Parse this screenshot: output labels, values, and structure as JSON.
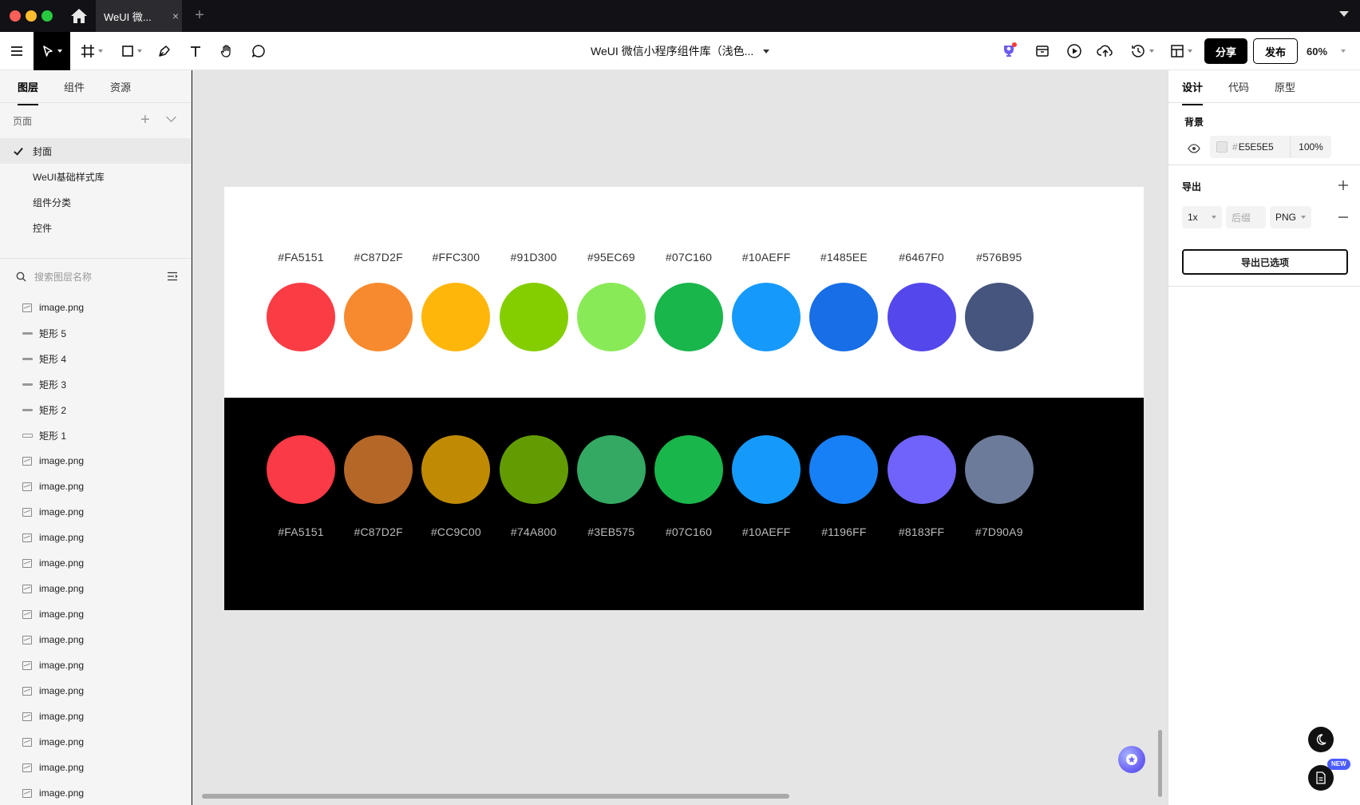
{
  "window": {
    "tab_title": "WeUI 微...",
    "tab_close": "×",
    "new_tab": "+"
  },
  "toolbar": {
    "tools": [
      "menu-icon",
      "move-tool",
      "frame-tool",
      "rectangle-tool",
      "pen-tool",
      "text-tool",
      "hand-tool",
      "comment-tool"
    ],
    "document_title": "WeUI 微信小程序组件库（浅色...",
    "share_label": "分享",
    "publish_label": "发布",
    "zoom": "60%"
  },
  "left_panel": {
    "tabs": [
      "图层",
      "组件",
      "资源"
    ],
    "pages_label": "页面",
    "pages": [
      "封面",
      "WeUI基础样式库",
      "组件分类",
      "控件"
    ],
    "search_placeholder": "搜索图层名称",
    "layers": [
      {
        "name": "image.png",
        "icon": "image-icon"
      },
      {
        "name": "矩形 5",
        "icon": "rectangle-icon"
      },
      {
        "name": "矩形 4",
        "icon": "rectangle-icon"
      },
      {
        "name": "矩形 3",
        "icon": "rectangle-icon"
      },
      {
        "name": "矩形 2",
        "icon": "rectangle-icon"
      },
      {
        "name": "矩形 1",
        "icon": "rectangle-outline-icon"
      },
      {
        "name": "image.png",
        "icon": "image-icon"
      },
      {
        "name": "image.png",
        "icon": "image-icon"
      },
      {
        "name": "image.png",
        "icon": "image-icon"
      },
      {
        "name": "image.png",
        "icon": "image-icon"
      },
      {
        "name": "image.png",
        "icon": "image-icon"
      },
      {
        "name": "image.png",
        "icon": "image-icon"
      },
      {
        "name": "image.png",
        "icon": "image-icon"
      },
      {
        "name": "image.png",
        "icon": "image-icon"
      },
      {
        "name": "image.png",
        "icon": "image-icon"
      },
      {
        "name": "image.png",
        "icon": "image-icon"
      },
      {
        "name": "image.png",
        "icon": "image-icon"
      },
      {
        "name": "image.png",
        "icon": "image-icon"
      },
      {
        "name": "image.png",
        "icon": "image-icon"
      },
      {
        "name": "image.png",
        "icon": "image-icon"
      }
    ]
  },
  "canvas": {
    "light_palette": [
      {
        "label": "#FA5151",
        "color": "#FA3C45"
      },
      {
        "label": "#C87D2F",
        "color": "#F78A2E"
      },
      {
        "label": "#FFC300",
        "color": "#FFB60A"
      },
      {
        "label": "#91D300",
        "color": "#84CE00"
      },
      {
        "label": "#95EC69",
        "color": "#89EA58"
      },
      {
        "label": "#07C160",
        "color": "#19B64C"
      },
      {
        "label": "#10AEFF",
        "color": "#159AFB"
      },
      {
        "label": "#1485EE",
        "color": "#176EE6"
      },
      {
        "label": "#6467F0",
        "color": "#5447EC"
      },
      {
        "label": "#576B95",
        "color": "#45557E"
      }
    ],
    "dark_palette": [
      {
        "label": "#FA5151",
        "color": "#FA3A46"
      },
      {
        "label": "#C87D2F",
        "color": "#B56728"
      },
      {
        "label": "#CC9C00",
        "color": "#C08B03"
      },
      {
        "label": "#74A800",
        "color": "#629C02"
      },
      {
        "label": "#3EB575",
        "color": "#33A963"
      },
      {
        "label": "#07C160",
        "color": "#19B64C"
      },
      {
        "label": "#10AEFF",
        "color": "#159AFB"
      },
      {
        "label": "#1196FF",
        "color": "#1780F7"
      },
      {
        "label": "#8183FF",
        "color": "#6F63FB"
      },
      {
        "label": "#7D90A9",
        "color": "#6B7B99"
      }
    ],
    "canvas_bg": "#E5E5E5"
  },
  "right_panel": {
    "tabs": [
      "设计",
      "代码",
      "原型"
    ],
    "background_label": "背景",
    "background_hex": "E5E5E5",
    "background_opacity": "100%",
    "export_label": "导出",
    "export_scale": "1x",
    "export_suffix_placeholder": "后缀",
    "export_format": "PNG",
    "export_button": "导出已选项",
    "new_badge": "NEW"
  }
}
